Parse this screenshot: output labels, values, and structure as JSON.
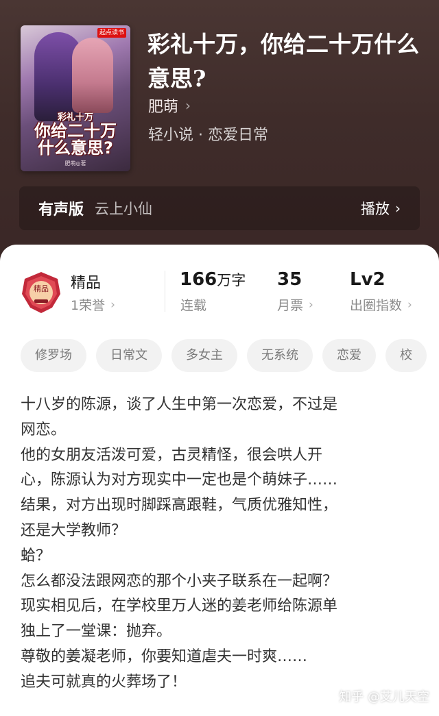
{
  "book": {
    "title": "彩礼十万，你给二十万什么意思?",
    "author": "肥萌",
    "genre": "轻小说 · 恋爱日常",
    "cover": {
      "publisher_badge": "起点读书",
      "title_line1": "彩礼十万",
      "title_line2": "你给二十万",
      "title_line3": "什么意思?",
      "author": "肥萌◎著"
    }
  },
  "audio": {
    "label": "有声版",
    "narrator": "云上小仙",
    "play_label": "播放"
  },
  "stats": {
    "quality_label": "精品",
    "honor": "1荣誉",
    "badge_text": "精品",
    "word_count": "166",
    "word_unit": "万字",
    "status": "连载",
    "monthly_tickets": "35",
    "monthly_label": "月票",
    "level": "Lv2",
    "level_label": "出圈指数"
  },
  "tags": [
    "修罗场",
    "日常文",
    "多女主",
    "无系统",
    "恋爱",
    "校"
  ],
  "summary": [
    "十八岁的陈源，谈了人生中第一次恋爱，不过是",
    "网恋。",
    "他的女朋友活泼可爱，古灵精怪，很会哄人开",
    "心，陈源认为对方现实中一定也是个萌妹子……",
    "结果，对方出现时脚踩高跟鞋，气质优雅知性，",
    "还是大学教师？",
    "蛤？",
    "怎么都没法跟网恋的那个小夹子联系在一起啊？",
    "现实相见后，在学校里万人迷的姜老师给陈源单",
    "独上了一堂课：抛弃。",
    "尊敬的姜凝老师，你要知道虐夫一时爽……",
    "追夫可就真的火葬场了！"
  ],
  "watermark": "知乎 @艾儿天空",
  "colors": {
    "hero_bg": "#3f2c2a",
    "tag_bg": "#f2f2f2",
    "badge_red": "#c2293a"
  }
}
